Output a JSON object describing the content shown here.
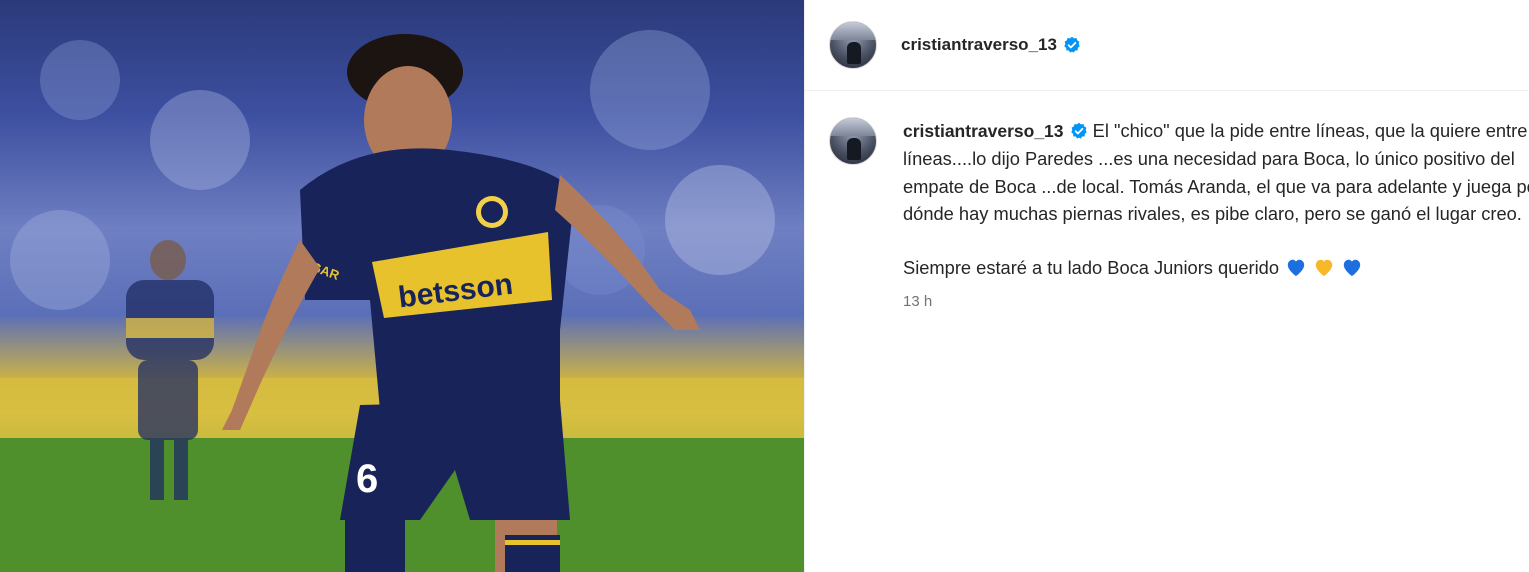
{
  "post": {
    "author": {
      "username": "cristiantraverso_13",
      "verified": true,
      "avatar_icon": "profile-photo-stadium"
    },
    "media": {
      "type": "photo",
      "jersey_text": "betsson",
      "sleeve_text": "ROGAR",
      "number_text": "6"
    },
    "caption": {
      "username": "cristiantraverso_13",
      "paragraph_1": "El \"chico\" que la pide entre líneas, que la quiere entre líneas....lo dijo Paredes ...es una necesidad para Boca, lo único positivo del empate de Boca ...de local. Tomás Aranda, el que va para adelante y juega por dónde hay muchas piernas rivales, es pibe claro, pero se ganó el lugar creo.",
      "paragraph_2": "Siempre estaré a tu lado Boca Juniors querido",
      "emojis": [
        "blue-heart-icon",
        "yellow-heart-icon",
        "blue-heart-icon"
      ],
      "timestamp": "13 h"
    },
    "colors": {
      "verified": "#0095f6",
      "blue_heart": "#1d6fe0",
      "yellow_heart": "#f7b82a",
      "text": "#262626",
      "muted": "#737373"
    }
  }
}
